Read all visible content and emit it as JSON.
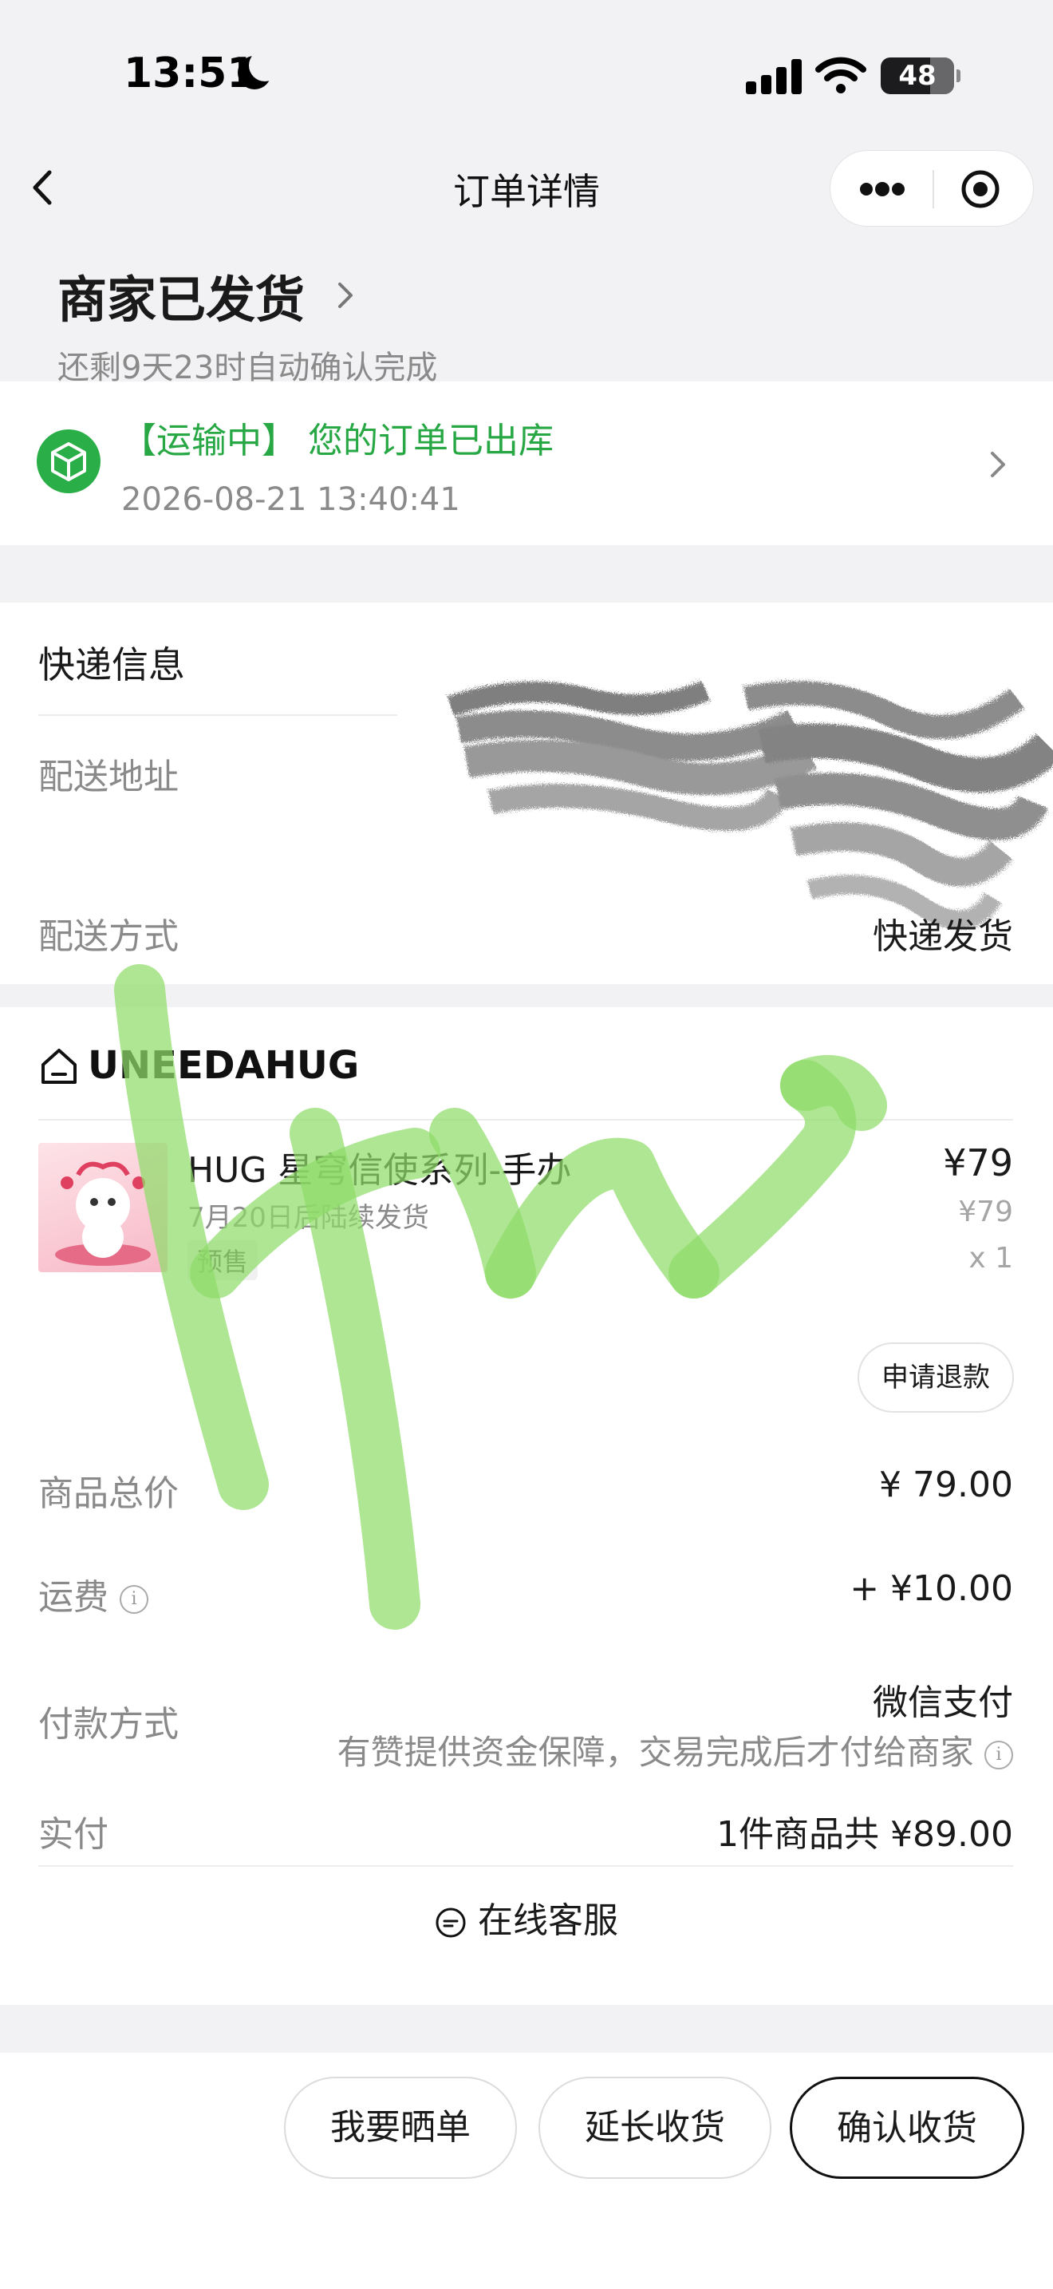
{
  "status_bar": {
    "time": "13:51",
    "battery": "48"
  },
  "nav": {
    "title": "订单详情"
  },
  "order_status": {
    "title": "商家已发货",
    "subtitle": "还剩9天23时自动确认完成"
  },
  "logistics": {
    "title": "【运输中】 您的订单已出库",
    "time": "2026-08-21 13:40:41"
  },
  "delivery": {
    "section_title": "快递信息",
    "address_label": "配送地址",
    "method_label": "配送方式",
    "method_value": "快递发货"
  },
  "shop": {
    "name": "UNEEDAHUG"
  },
  "product": {
    "name": "HUG 星穹信使系列-手办",
    "note": "7月20日后陆续发货",
    "tag": "预售",
    "price": "¥79",
    "original_price": "¥79",
    "quantity": "x 1",
    "refund_button": "申请退款"
  },
  "summary": {
    "goods_total_label": "商品总价",
    "goods_total_value": "¥ 79.00",
    "shipping_label": "运费",
    "shipping_value": "+ ¥10.00",
    "payment_label": "付款方式",
    "payment_value": "微信支付",
    "payment_note": "有赞提供资金保障，交易完成后才付给商家",
    "paid_label": "实付",
    "paid_value": "1件商品共 ¥89.00"
  },
  "service": {
    "label": "在线客服"
  },
  "actions": {
    "share": "我要晒单",
    "extend": "延长收货",
    "confirm": "确认收货"
  },
  "colors": {
    "accent_green": "#27a845",
    "status_badge": "#2aae47",
    "scrawl": "#8fdc6a"
  }
}
